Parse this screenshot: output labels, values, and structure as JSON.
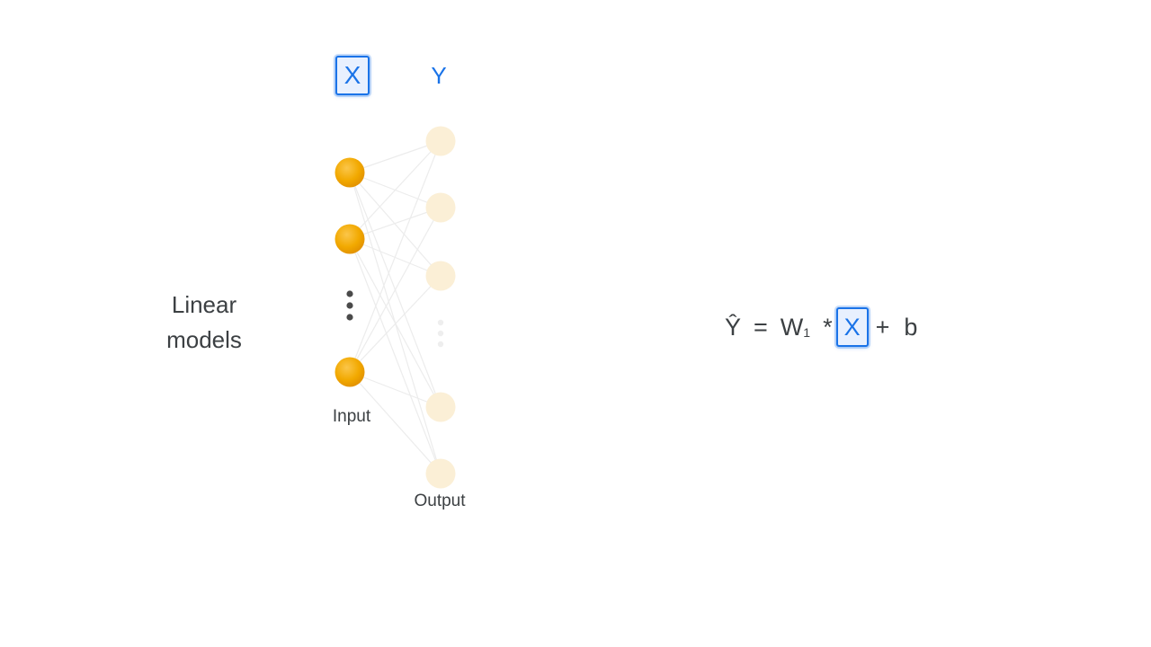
{
  "title": {
    "line1": "Linear",
    "line2": "models"
  },
  "columns": {
    "input_header": "X",
    "output_header": "Y"
  },
  "layers": {
    "input_label": "Input",
    "output_label": "Output"
  },
  "equation": {
    "y_hat": "Ŷ",
    "equals": "=",
    "weight": "W",
    "weight_subscript": "1",
    "times": "*",
    "input": "X",
    "plus": "+",
    "bias": "b"
  },
  "colors": {
    "input_node": "#f2a900",
    "output_node": "#fbefd6",
    "highlight": "#1a73e8",
    "text": "#3c4043"
  }
}
